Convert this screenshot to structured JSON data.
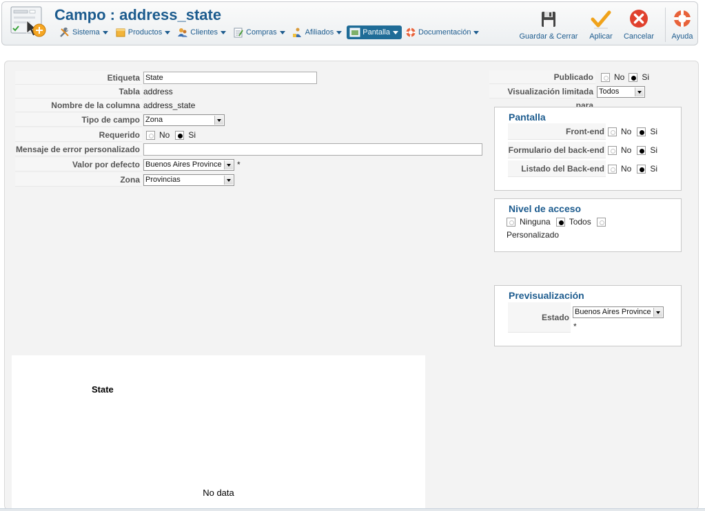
{
  "header": {
    "title": "Campo : address_state",
    "menu": [
      {
        "label": "Sistema",
        "icon": "wrench-icon"
      },
      {
        "label": "Productos",
        "icon": "products-icon"
      },
      {
        "label": "Clientes",
        "icon": "clients-icon"
      },
      {
        "label": "Compras",
        "icon": "orders-icon"
      },
      {
        "label": "Afiliados",
        "icon": "affiliates-icon"
      },
      {
        "label": "Pantalla",
        "icon": "display-icon"
      },
      {
        "label": "Documentación",
        "icon": "lifebuoy-icon"
      }
    ],
    "toolbar": {
      "save_close": "Guardar & Cerrar",
      "apply": "Aplicar",
      "cancel": "Cancelar",
      "help": "Ayuda"
    }
  },
  "form": {
    "etiqueta": {
      "label": "Etiqueta",
      "value": "State"
    },
    "tabla": {
      "label": "Tabla",
      "value": "address"
    },
    "columna": {
      "label": "Nombre de la columna",
      "value": "address_state"
    },
    "tipo": {
      "label": "Tipo de campo",
      "value": "Zona"
    },
    "requerido": {
      "label": "Requerido",
      "no": "No",
      "si": "Si",
      "selected": "Si"
    },
    "error": {
      "label": "Mensaje de error personalizado",
      "value": ""
    },
    "defecto": {
      "label": "Valor por defecto",
      "value": "Buenos Aires Province",
      "required_mark": "*"
    },
    "zona": {
      "label": "Zona",
      "value": "Provincias"
    }
  },
  "right": {
    "publicado": {
      "label": "Publicado",
      "no": "No",
      "si": "Si",
      "selected": "Si"
    },
    "visualizacion": {
      "label": "Visualización limitada para",
      "value": "Todos"
    },
    "pantalla": {
      "legend": "Pantalla",
      "rows": [
        {
          "label": "Front-end",
          "no": "No",
          "si": "Si",
          "selected": "Si"
        },
        {
          "label": "Formulario del back-end",
          "no": "No",
          "si": "Si",
          "selected": "Si"
        },
        {
          "label": "Listado del Back-end",
          "no": "No",
          "si": "Si",
          "selected": "Si"
        }
      ]
    },
    "acceso": {
      "legend": "Nivel de acceso",
      "options": [
        "Ninguna",
        "Todos",
        "Personalizado"
      ],
      "selected": "Todos"
    },
    "preview": {
      "legend": "Previsualización",
      "label": "Estado",
      "value": "Buenos Aires Province",
      "required_mark": "*"
    }
  },
  "preview_area": {
    "title": "State",
    "message": "No data"
  },
  "colors": {
    "accent": "#1c5b8e",
    "active_menu": "#1f6c97",
    "cancel": "#e0412e",
    "apply": "#f0a21a"
  }
}
